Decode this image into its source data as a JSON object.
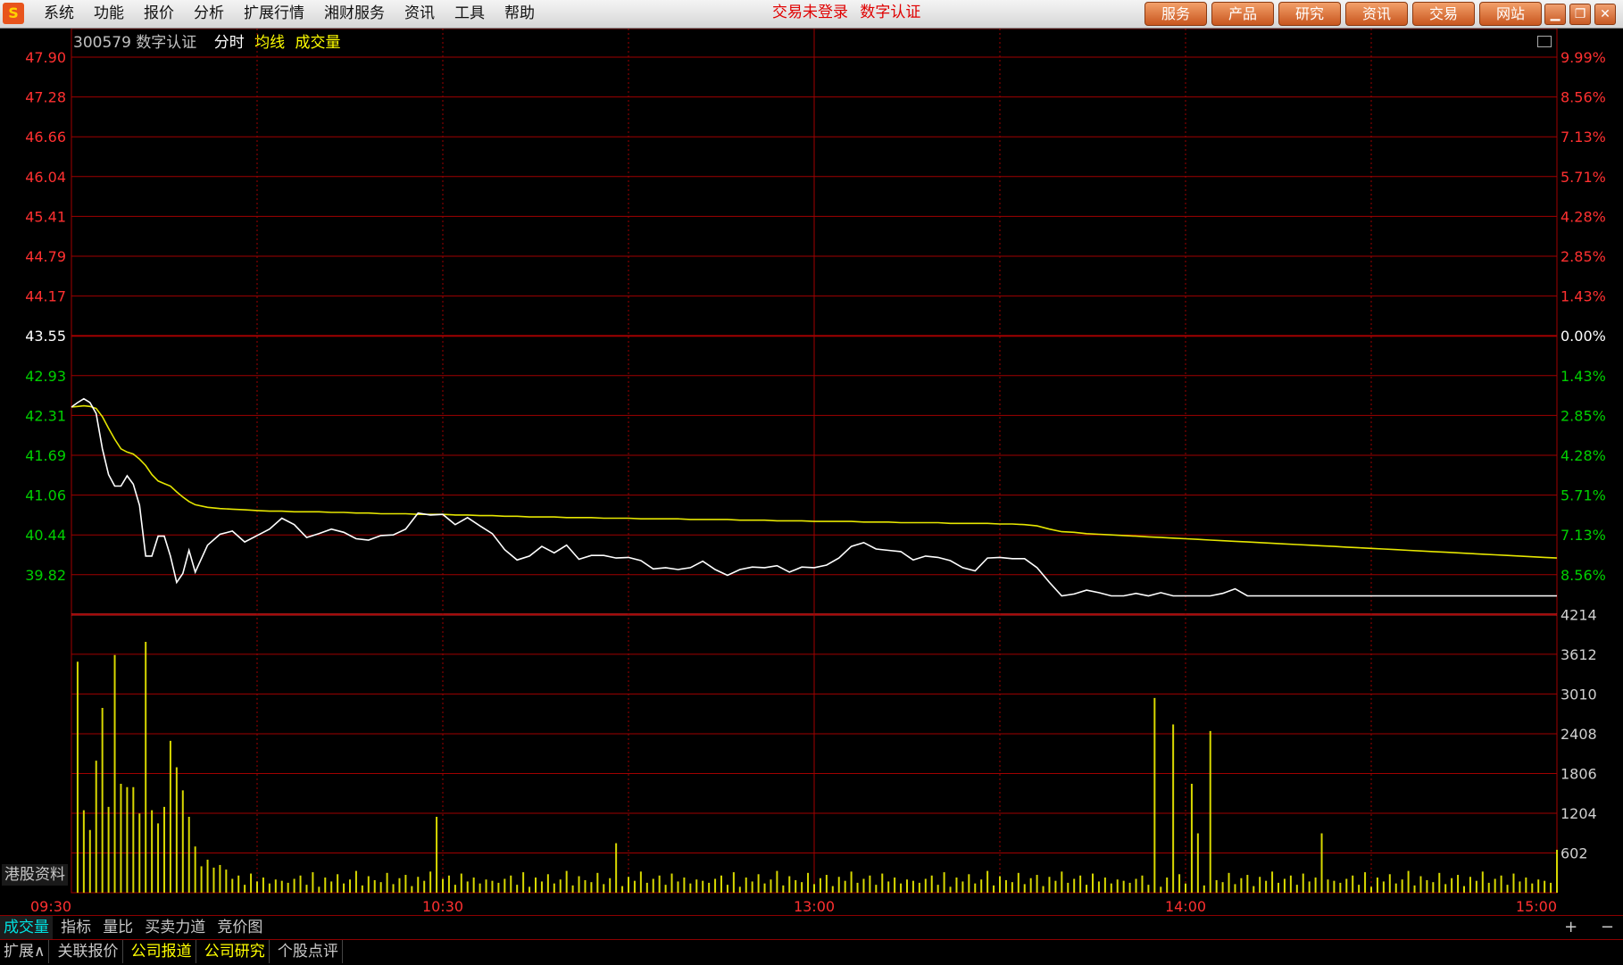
{
  "app": {
    "menu": [
      "系统",
      "功能",
      "报价",
      "分析",
      "扩展行情",
      "湘财服务",
      "资讯",
      "工具",
      "帮助"
    ],
    "status": [
      "交易未登录",
      "数字认证"
    ],
    "top_buttons": [
      "服务",
      "产品",
      "研究",
      "资讯",
      "交易",
      "网站"
    ],
    "logo_glyph": "S"
  },
  "stock": {
    "code": "300579",
    "name": "数字认证",
    "tabs": [
      "分时",
      "均线",
      "成交量"
    ]
  },
  "side_label": "港股资料",
  "bottom_tabs": [
    "成交量",
    "指标",
    "量比",
    "买卖力道",
    "竞价图"
  ],
  "zoom": [
    "+",
    "−"
  ],
  "footer_tabs": [
    {
      "label": "扩展∧",
      "style": "plain"
    },
    {
      "label": "关联报价",
      "style": "plain"
    },
    {
      "label": "公司报道",
      "style": "hl"
    },
    {
      "label": "公司研究",
      "style": "hl"
    },
    {
      "label": "个股点评",
      "style": "plain"
    }
  ],
  "colors": {
    "up": "#ff3030",
    "down": "#00d000",
    "neutral": "#ffffff",
    "grid": "#a00000",
    "price_line": "#ffffff",
    "avg_line": "#e6e600",
    "volume_bar": "#d8d800"
  },
  "chart_data": {
    "type": "line",
    "title": "",
    "prev_close": 43.55,
    "price_ticks": [
      "47.90",
      "47.28",
      "46.66",
      "46.04",
      "45.41",
      "44.79",
      "44.17",
      "43.55",
      "42.93",
      "42.31",
      "41.69",
      "41.06",
      "40.44",
      "39.82"
    ],
    "pct_ticks": [
      "9.99%",
      "8.56%",
      "7.13%",
      "5.71%",
      "4.28%",
      "2.85%",
      "1.43%",
      "0.00%",
      "1.43%",
      "2.85%",
      "4.28%",
      "5.71%",
      "7.13%",
      "8.56%"
    ],
    "ylim": [
      39.2,
      47.9
    ],
    "volume_ticks": [
      "4214",
      "3612",
      "3010",
      "2408",
      "1806",
      "1204",
      "602"
    ],
    "volume_ylim": [
      0,
      4214
    ],
    "time_labels": [
      "09:30",
      "10:30",
      "13:00",
      "14:00",
      "15:00"
    ],
    "x_minutes": [
      0,
      1,
      2,
      3,
      4,
      5,
      6,
      7,
      8,
      9,
      10,
      11,
      12,
      13,
      14,
      15,
      16,
      17,
      18,
      19,
      20,
      22,
      24,
      26,
      28,
      30,
      32,
      34,
      36,
      38,
      40,
      42,
      44,
      46,
      48,
      50,
      52,
      54,
      56,
      58,
      60,
      62,
      64,
      66,
      68,
      70,
      72,
      74,
      76,
      78,
      80,
      82,
      84,
      86,
      88,
      90,
      92,
      94,
      96,
      98,
      100,
      102,
      104,
      106,
      108,
      110,
      112,
      114,
      116,
      118,
      120,
      122,
      124,
      126,
      128,
      130,
      132,
      134,
      136,
      138,
      140,
      142,
      144,
      146,
      148,
      150,
      152,
      154,
      156,
      158,
      160,
      162,
      164,
      166,
      168,
      170,
      172,
      174,
      176,
      178,
      180,
      182,
      184,
      186,
      188,
      190,
      192,
      194,
      196,
      198,
      200,
      202,
      204,
      206,
      208,
      210,
      212,
      214,
      216,
      218,
      220,
      222,
      224,
      226,
      228,
      230,
      232,
      234,
      236,
      238,
      240
    ],
    "series": [
      {
        "values": [
          42.45,
          42.52,
          42.58,
          42.52,
          42.35,
          41.8,
          41.4,
          41.22,
          41.22,
          41.38,
          41.25,
          40.92,
          40.13,
          40.13,
          40.44,
          40.44,
          40.13,
          39.72,
          39.86,
          40.22,
          39.88,
          40.3,
          40.47,
          40.52,
          40.35,
          40.45,
          40.55,
          40.72,
          40.62,
          40.42,
          40.48,
          40.55,
          40.5,
          40.4,
          40.38,
          40.45,
          40.46,
          40.55,
          40.8,
          40.77,
          40.78,
          40.62,
          40.73,
          40.6,
          40.48,
          40.23,
          40.07,
          40.13,
          40.28,
          40.18,
          40.3,
          40.08,
          40.14,
          40.14,
          40.1,
          40.11,
          40.06,
          39.93,
          39.95,
          39.92,
          39.95,
          40.05,
          39.92,
          39.83,
          39.92,
          39.96,
          39.95,
          39.98,
          39.88,
          39.96,
          39.95,
          39.99,
          40.1,
          40.28,
          40.34,
          40.24,
          40.22,
          40.2,
          40.07,
          40.13,
          40.11,
          40.06,
          39.95,
          39.9,
          40.1,
          40.11,
          40.09,
          40.09,
          39.95,
          39.72,
          39.51,
          39.54,
          39.6,
          39.56,
          39.51,
          39.51,
          39.55,
          39.51,
          39.56,
          39.51,
          39.51,
          39.51,
          39.51,
          39.55,
          39.62,
          39.51,
          39.51,
          39.51,
          39.51,
          39.51,
          39.51,
          39.51,
          39.51,
          39.51,
          39.51,
          39.51,
          39.51,
          39.51,
          39.51,
          39.51,
          39.51,
          39.51,
          39.51,
          39.51,
          39.51,
          39.51,
          39.51,
          39.51,
          39.51,
          39.51,
          39.51,
          39.51,
          39.51,
          39.51,
          39.51
        ]
      },
      {
        "values": [
          42.45,
          42.46,
          42.47,
          42.46,
          42.43,
          42.3,
          42.12,
          41.95,
          41.8,
          41.75,
          41.72,
          41.64,
          41.54,
          41.4,
          41.3,
          41.26,
          41.22,
          41.13,
          41.05,
          40.98,
          40.93,
          40.89,
          40.87,
          40.86,
          40.85,
          40.84,
          40.83,
          40.83,
          40.82,
          40.82,
          40.82,
          40.81,
          40.81,
          40.8,
          40.8,
          40.79,
          40.79,
          40.79,
          40.78,
          40.78,
          40.78,
          40.77,
          40.77,
          40.76,
          40.76,
          40.75,
          40.75,
          40.74,
          40.74,
          40.74,
          40.73,
          40.73,
          40.73,
          40.72,
          40.72,
          40.72,
          40.71,
          40.71,
          40.71,
          40.71,
          40.7,
          40.7,
          40.7,
          40.7,
          40.69,
          40.69,
          40.69,
          40.68,
          40.68,
          40.68,
          40.67,
          40.67,
          40.67,
          40.67,
          40.66,
          40.66,
          40.66,
          40.65,
          40.65,
          40.65,
          40.65,
          40.64,
          40.64,
          40.64,
          40.64,
          40.63,
          40.63,
          40.62,
          40.6,
          40.55,
          40.51,
          40.5,
          40.48,
          40.47,
          40.46,
          40.45,
          40.44,
          40.43,
          40.42,
          40.41,
          40.4,
          40.39,
          40.38,
          40.37,
          40.36,
          40.35,
          40.34,
          40.33,
          40.32,
          40.31,
          40.3,
          40.29,
          40.28,
          40.27,
          40.26,
          40.25,
          40.24,
          40.23,
          40.22,
          40.21,
          40.2,
          40.19,
          40.18,
          40.17,
          40.16,
          40.15,
          40.14,
          40.13,
          40.12,
          40.11,
          40.1,
          40.09,
          40.08,
          40.07,
          40.06,
          40.05,
          40.04
        ]
      }
    ],
    "volume_spike_minutes": [
      1,
      2,
      3,
      4,
      5,
      6,
      7,
      8,
      9,
      10,
      11,
      12,
      13,
      14,
      15,
      16,
      17,
      18,
      19,
      20,
      21,
      22,
      23,
      24,
      25,
      59,
      88,
      175,
      178,
      181,
      182,
      184,
      202,
      240
    ],
    "volume_spike_values": [
      3500,
      1250,
      950,
      2000,
      2800,
      1300,
      3600,
      1650,
      1600,
      1600,
      1200,
      3800,
      1250,
      1050,
      1300,
      2300,
      1900,
      1550,
      1150,
      700,
      400,
      500,
      380,
      420,
      350,
      1150,
      750,
      2950,
      2550,
      1650,
      900,
      2450,
      900,
      650
    ],
    "volume_base_values": [
      180,
      150,
      210,
      260,
      120,
      310,
      90,
      230,
      170,
      280,
      140,
      200,
      330,
      110,
      250,
      190,
      160,
      300,
      130,
      220,
      270,
      100,
      240,
      180,
      320,
      150,
      210,
      260,
      120,
      290,
      170,
      230,
      140,
      200
    ]
  }
}
